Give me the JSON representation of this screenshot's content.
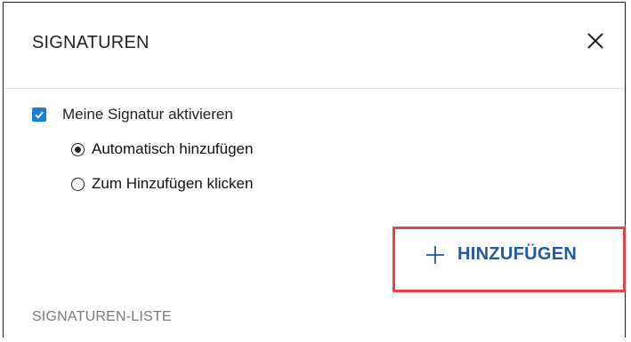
{
  "dialog": {
    "title": "SIGNATUREN",
    "close_icon": "close-icon"
  },
  "settings": {
    "enable_label": "Meine Signatur aktivieren",
    "enable_checked": true,
    "options": [
      {
        "label": "Automatisch hinzufügen",
        "selected": true
      },
      {
        "label": "Zum Hinzufügen klicken",
        "selected": false
      }
    ]
  },
  "actions": {
    "add_label": "HINZUFÜGEN",
    "add_icon": "plus-icon"
  },
  "list": {
    "title": "SIGNATUREN-LISTE"
  },
  "colors": {
    "accent": "#1e7fd6",
    "button_text": "#1d5aa8",
    "highlight": "#e8434c",
    "muted_text": "#7a7a7a"
  }
}
